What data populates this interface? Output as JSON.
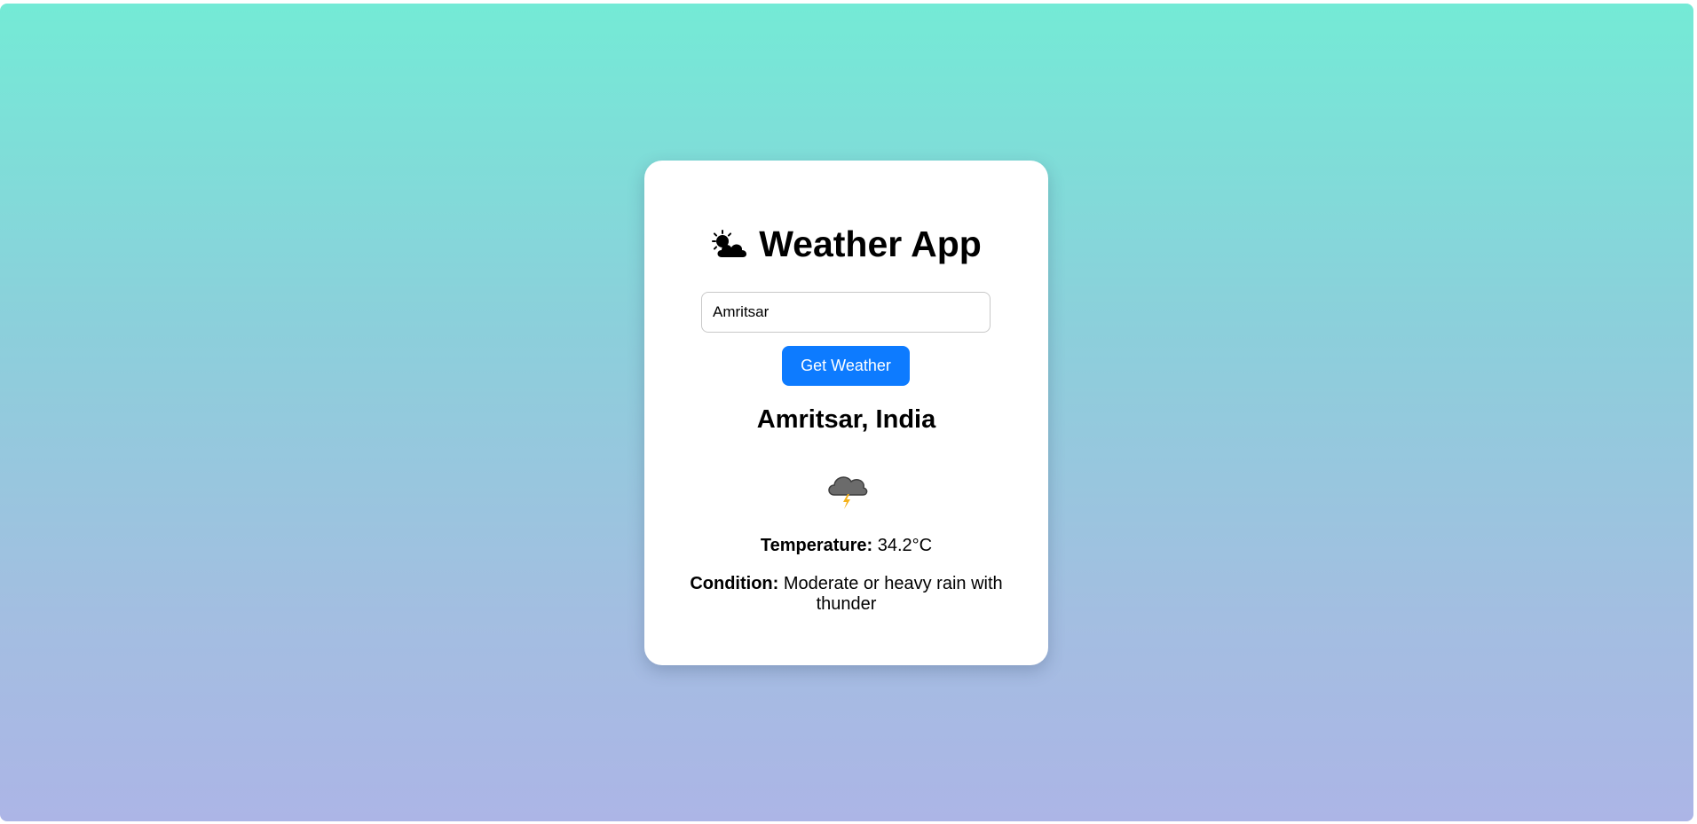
{
  "app": {
    "title": "Weather App",
    "title_icon": "sun-behind-cloud-icon"
  },
  "search": {
    "value": "Amritsar",
    "button_label": "Get Weather"
  },
  "result": {
    "location": "Amritsar, India",
    "weather_icon": "thunder-cloud-icon",
    "temperature_label": "Temperature:",
    "temperature_value": "34.2°C",
    "condition_label": "Condition:",
    "condition_value": "Moderate or heavy rain with thunder"
  },
  "colors": {
    "button": "#0d7bff",
    "gradient_top": "#74ead6",
    "gradient_bottom": "#acb5e6"
  }
}
